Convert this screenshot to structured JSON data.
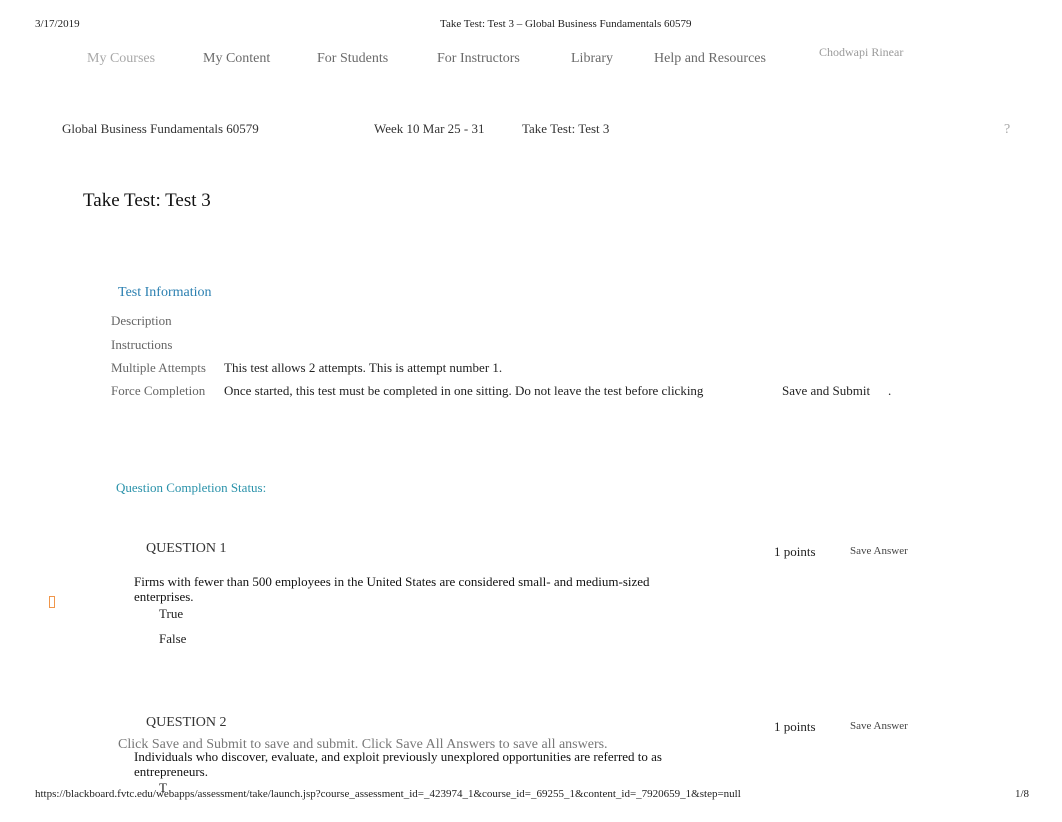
{
  "print_header": {
    "date": "3/17/2019",
    "title": "Take Test: Test 3 – Global Business Fundamentals 60579"
  },
  "nav": {
    "items": [
      {
        "label": "My Courses"
      },
      {
        "label": "My Content"
      },
      {
        "label": "For Students"
      },
      {
        "label": "For Instructors"
      },
      {
        "label": "Library"
      },
      {
        "label": "Help and Resources"
      }
    ],
    "user_name": "Chodwapi Rinear"
  },
  "breadcrumb": {
    "items": [
      {
        "label": "Global Business Fundamentals 60579"
      },
      {
        "label": "Week 10 Mar 25 - 31"
      },
      {
        "label": "Take Test: Test 3"
      }
    ],
    "help_icon": "?"
  },
  "page_title": "Take Test: Test 3",
  "test_info": {
    "heading": "Test Information",
    "rows": [
      {
        "label": "Description",
        "value": ""
      },
      {
        "label": "Instructions",
        "value": ""
      },
      {
        "label": "Multiple Attempts",
        "value": "This test allows 2 attempts. This is attempt number 1."
      },
      {
        "label": "Force Completion",
        "value": "Once started, this test must be completed in one sitting. Do not leave the test before clicking",
        "link": "Save and Submit",
        "suffix": "."
      }
    ]
  },
  "completion_status": {
    "label": "Question Completion Status:"
  },
  "questions": [
    {
      "title": "QUESTION 1",
      "points": "1 points",
      "save_label": "Save Answer",
      "text": "Firms with fewer than 500 employees in the United States are considered small- and medium-sized enterprises.",
      "options": [
        "True",
        "False"
      ],
      "flag_icon": "flag-icon"
    },
    {
      "title": "QUESTION 2",
      "points": "1 points",
      "save_label": "Save Answer",
      "text": "Individuals who discover, evaluate, and exploit previously unexplored opportunities are referred to as entrepreneurs.",
      "options": [
        "T"
      ]
    }
  ],
  "footer": {
    "hint": "Click Save and Submit to save and submit. Click Save All Answers to save all answers.",
    "url": "https://blackboard.fvtc.edu/webapps/assessment/take/launch.jsp?course_assessment_id=_423974_1&course_id=_69255_1&content_id=_7920659_1&step=null",
    "page": "1/8"
  }
}
